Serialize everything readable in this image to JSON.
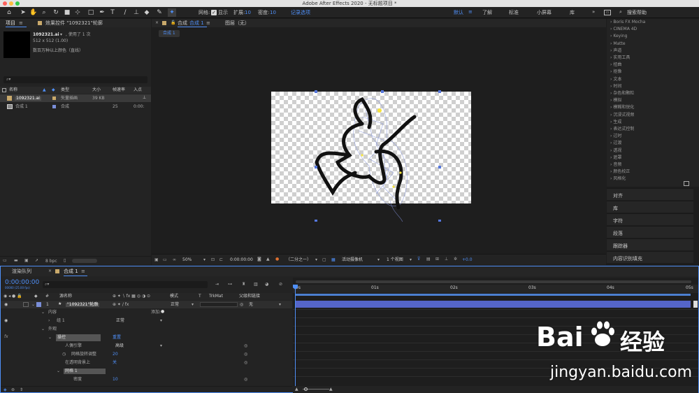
{
  "window": {
    "title": "Adobe After Effects 2020 - 无标题项目 *"
  },
  "toolbar": {
    "grid_label": "网格:",
    "display_label": "显示",
    "expand_label": "扩展:",
    "expand_value": "10",
    "density_label": "密度:",
    "density_value": "10",
    "record_label": "记录选项",
    "workspaces": [
      "默认",
      "了解",
      "标准",
      "小屏幕",
      "库"
    ],
    "search_placeholder": "搜索帮助"
  },
  "project": {
    "tab": "项目",
    "fx_tab": "效果控件 \"1092321\"轮廓",
    "file_name": "1092321.ai",
    "file_used": ", 使用了 1 次",
    "file_dims": "512 x 512 (1.00)",
    "file_color": "数百万种以上颜色（直线）",
    "columns": {
      "name": "名称",
      "type": "类型",
      "size": "大小",
      "fps": "帧速率",
      "in": "入点"
    },
    "items": [
      {
        "name": "1092321.ai",
        "type": "矢量插画",
        "size": "39 KB",
        "fps": "",
        "in": ""
      },
      {
        "name": "合成 1",
        "type": "合成",
        "size": "",
        "fps": "25",
        "in": "0:00:"
      }
    ],
    "bpc": "8 bpc"
  },
  "viewer": {
    "comp_tab": "合成",
    "comp_name": "合成 1",
    "layer_tab": "图层（无）",
    "breadcrumb": "合成 1",
    "zoom": "50%",
    "timecode": "0:00:00:00",
    "resolution": "（二分之一）",
    "camera": "活动摄像机",
    "views": "1 个视图",
    "exposure": "+0.0"
  },
  "effects_list": [
    "Boris FX Mocha",
    "CINEMA 4D",
    "Keying",
    "Matte",
    "声道",
    "实用工具",
    "扭曲",
    "抠像",
    "文本",
    "时间",
    "杂色和颗粒",
    "模拟",
    "模糊和锐化",
    "沉浸式视频",
    "生成",
    "表达式控制",
    "过时",
    "过渡",
    "透视",
    "遮罩",
    "音频",
    "颜色校正",
    "风格化"
  ],
  "right_panels": [
    "对齐",
    "库",
    "字符",
    "段落",
    "跟踪器",
    "内容识别填充"
  ],
  "timeline": {
    "render_tab": "渲染队列",
    "comp_tab": "合成 1",
    "timecode": "0:00:00:00",
    "timecode_sub": "00000 (25.00 fps)",
    "columns": {
      "src": "源名称",
      "mode": "模式",
      "trkmat": "TrkMat",
      "parent": "父级和链接"
    },
    "layer": {
      "num": "1",
      "name": "\"1092321\"轮廓",
      "mode": "正常",
      "parent": "无"
    },
    "props": {
      "content": "内容",
      "add": "添加:",
      "group": "组 1",
      "group_mode": "正常",
      "geometry": "外观",
      "puppet": "操控",
      "reset": "重置",
      "engine": "人偶引擎",
      "engine_value": "高级",
      "rotate": "网格旋转调整",
      "rotate_value": "20",
      "on_bg": "在透明背景上",
      "on_bg_value": "关",
      "mesh": "网格 1",
      "density": "密度",
      "density_value": "10"
    },
    "ruler": [
      "0s",
      "01s",
      "02s",
      "03s",
      "04s",
      "05s"
    ]
  },
  "watermark": {
    "brand": "Bai",
    "brand_right": "经验",
    "url": "jingyan.baidu.com"
  },
  "colors": {
    "accent": "#4f8ff7",
    "layer_bar": "#5565c9",
    "label_tan": "#c9a96b",
    "label_blue": "#7a8ed8"
  }
}
